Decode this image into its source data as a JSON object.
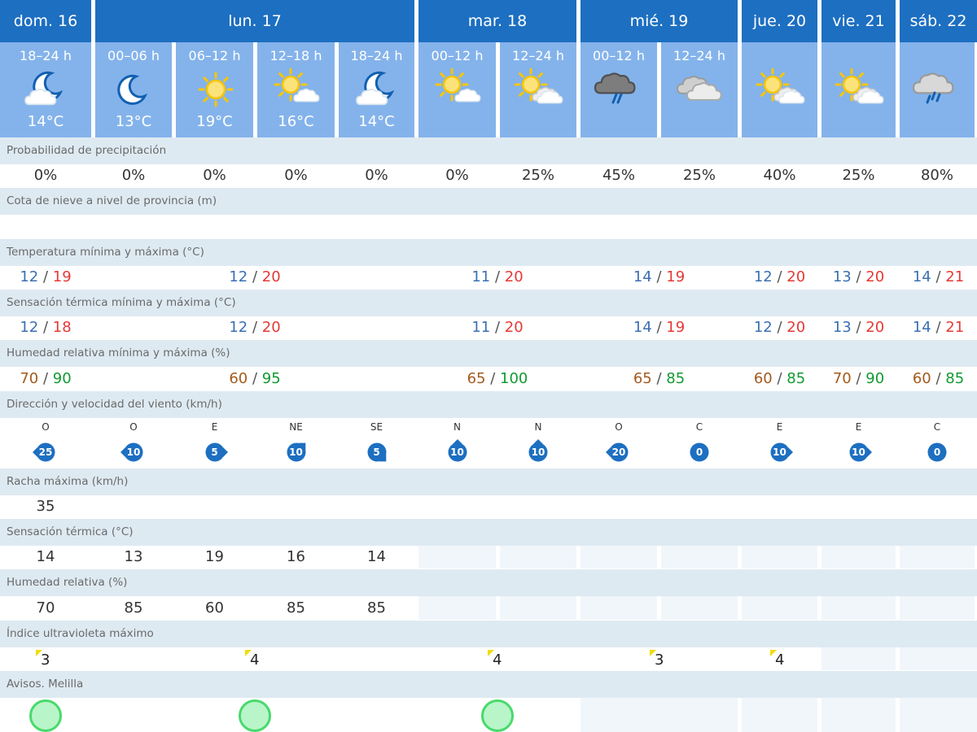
{
  "days": [
    {
      "label": "dom. 16"
    },
    {
      "label": "lun. 17"
    },
    {
      "label": "mar. 18"
    },
    {
      "label": "mié. 19"
    },
    {
      "label": "jue. 20"
    },
    {
      "label": "vie. 21"
    },
    {
      "label": "sáb. 22"
    }
  ],
  "periods": [
    {
      "label": "18–24 h",
      "icon": "moon-cloud-icon",
      "temp": "14°C"
    },
    {
      "label": "00–06 h",
      "icon": "moon-icon",
      "temp": "13°C"
    },
    {
      "label": "06–12 h",
      "icon": "sun-icon",
      "temp": "19°C"
    },
    {
      "label": "12–18 h",
      "icon": "sun-cloud-icon",
      "temp": "16°C"
    },
    {
      "label": "18–24 h",
      "icon": "moon-cloud-icon",
      "temp": "14°C"
    },
    {
      "label": "00–12 h",
      "icon": "sun-cloud-icon",
      "temp": ""
    },
    {
      "label": "12–24 h",
      "icon": "sun-clouds-icon",
      "temp": ""
    },
    {
      "label": "00–12 h",
      "icon": "storm-rain-icon",
      "temp": ""
    },
    {
      "label": "12–24 h",
      "icon": "clouds-icon",
      "temp": ""
    },
    {
      "label": "",
      "icon": "sun-clouds-icon",
      "temp": ""
    },
    {
      "label": "",
      "icon": "sun-clouds-icon",
      "temp": ""
    },
    {
      "label": "",
      "icon": "cloud-rain-icon",
      "temp": ""
    }
  ],
  "rows": {
    "precip": {
      "label": "Probabilidad de precipitación",
      "values": [
        "0%",
        "0%",
        "0%",
        "0%",
        "0%",
        "0%",
        "25%",
        "45%",
        "25%",
        "40%",
        "25%",
        "80%"
      ]
    },
    "snow": {
      "label": "Cota de nieve a nivel de provincia (m)",
      "values": [
        "",
        "",
        "",
        "",
        "",
        "",
        "",
        "",
        "",
        "",
        "",
        ""
      ]
    },
    "temp_minmax": {
      "label": "Temperatura mínima y máxima (°C)",
      "values": [
        {
          "min": "12",
          "max": "19"
        },
        {
          "min": "12",
          "max": "20"
        },
        {
          "min": "11",
          "max": "20"
        },
        {
          "min": "14",
          "max": "19"
        },
        {
          "min": "12",
          "max": "20"
        },
        {
          "min": "13",
          "max": "20"
        },
        {
          "min": "14",
          "max": "21"
        }
      ]
    },
    "feel_minmax": {
      "label": "Sensación térmica mínima y máxima (°C)",
      "values": [
        {
          "min": "12",
          "max": "18"
        },
        {
          "min": "12",
          "max": "20"
        },
        {
          "min": "11",
          "max": "20"
        },
        {
          "min": "14",
          "max": "19"
        },
        {
          "min": "12",
          "max": "20"
        },
        {
          "min": "13",
          "max": "20"
        },
        {
          "min": "14",
          "max": "21"
        }
      ]
    },
    "humidity_minmax": {
      "label": "Humedad relativa mínima y máxima (%)",
      "values": [
        {
          "min": "70",
          "max": "90"
        },
        {
          "min": "60",
          "max": "95"
        },
        {
          "min": "65",
          "max": "100"
        },
        {
          "min": "65",
          "max": "85"
        },
        {
          "min": "60",
          "max": "85"
        },
        {
          "min": "70",
          "max": "90"
        },
        {
          "min": "60",
          "max": "85"
        }
      ]
    },
    "wind": {
      "label": "Dirección y velocidad del viento (km/h)",
      "values": [
        {
          "dir": "O",
          "speed": "25"
        },
        {
          "dir": "O",
          "speed": "10"
        },
        {
          "dir": "E",
          "speed": "5"
        },
        {
          "dir": "NE",
          "speed": "10"
        },
        {
          "dir": "SE",
          "speed": "5"
        },
        {
          "dir": "N",
          "speed": "10"
        },
        {
          "dir": "N",
          "speed": "10"
        },
        {
          "dir": "O",
          "speed": "20"
        },
        {
          "dir": "C",
          "speed": "0"
        },
        {
          "dir": "E",
          "speed": "10"
        },
        {
          "dir": "E",
          "speed": "10"
        },
        {
          "dir": "C",
          "speed": "0"
        }
      ]
    },
    "gust": {
      "label": "Racha máxima (km/h)",
      "values": [
        "35",
        "",
        "",
        "",
        "",
        "",
        "",
        "",
        "",
        "",
        "",
        ""
      ]
    },
    "feel": {
      "label": "Sensación térmica (°C)",
      "values": [
        "14",
        "13",
        "19",
        "16",
        "14"
      ]
    },
    "humidity": {
      "label": "Humedad relativa (%)",
      "values": [
        "70",
        "85",
        "60",
        "85",
        "85"
      ]
    },
    "uv": {
      "label": "Índice ultravioleta máximo",
      "values": [
        "3",
        "4",
        "4",
        "3",
        "4"
      ]
    },
    "alerts": {
      "label": "Avisos. Melilla",
      "values": [
        "green",
        "green",
        "green"
      ]
    }
  },
  "colors": {
    "header_bg": "#1d6fc1",
    "period_bg": "#84b3eb",
    "label_row_bg": "#deeaf2",
    "temp_min": "#3b6fb3",
    "temp_max": "#e53935",
    "humidity_min": "#a35a1c",
    "humidity_max": "#119a30",
    "wind_badge": "#1d6fc1",
    "alert_green": "#49d96c",
    "uv_flag": "#f2dc0a"
  }
}
